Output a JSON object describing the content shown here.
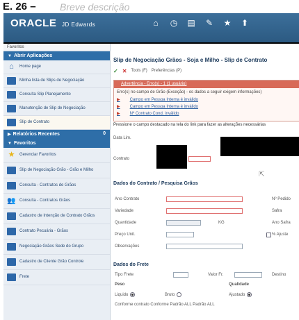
{
  "caption": {
    "label": "E. 26 –",
    "description": "Breve descrição"
  },
  "header": {
    "logo": "ORACLE",
    "logo_suffix": "JD Edwards",
    "icons": [
      "home-icon",
      "clock-icon",
      "grid-icon",
      "edit-icon",
      "star-icon",
      "pin-icon"
    ]
  },
  "sidebar": {
    "favorites": "Favoritos",
    "my_sections_title": "Abrir Aplicações",
    "items": [
      {
        "label": "Home page",
        "icon": "home"
      },
      {
        "label": "Minha lista de Slips de Negociação",
        "icon": "doc"
      },
      {
        "label": "Consulta Slip Planejamento",
        "icon": "doc"
      },
      {
        "label": "Manutenção de Slip de Negociação",
        "icon": "doc"
      },
      {
        "label": "Slip de Contrato",
        "icon": "doc"
      }
    ],
    "recent_title": "Relatórios Recentes",
    "recent_count": "0",
    "favorites_title": "Favoritos",
    "fav_items": [
      {
        "label": "Gerenciar Favoritos",
        "icon": "star"
      },
      {
        "label": "Slip de Negociação Grão - Grão e Milho",
        "icon": "doc"
      },
      {
        "label": "Consulta - Contratos de Grãos",
        "icon": "doc"
      },
      {
        "label": "Consulta - Contratos Grãos",
        "icon": "people"
      },
      {
        "label": "Cadastro de Intenção de Contrato Grãos",
        "icon": "doc"
      },
      {
        "label": "Contrato Pecuária - Grãos",
        "icon": "doc"
      },
      {
        "label": "Negociação Grãos Sede do Grupo",
        "icon": "doc"
      },
      {
        "label": "Cadastro de Cliente Grão Controle",
        "icon": "doc"
      },
      {
        "label": "Frete",
        "icon": "doc"
      }
    ]
  },
  "main": {
    "title": "Slip de Negociação Grãos - Soja e Milho - Slip de Contrato",
    "toolbar": {
      "ok": "✓",
      "cancel": "✕",
      "tools": "Tools (F)",
      "prefs": "Preferências (P)"
    },
    "alert": {
      "tag": "Advertência - Erro(s) - 1 (1 usuário)",
      "lines": [
        "Erro(s) no campo de Grão (Exceção) - os dados a seguir exigem informações)",
        "Campo em Pessoa Interna é inválido",
        "Campo em Pessoa Interna é inválido",
        "Nº Contrato Cond. inválido"
      ],
      "info": "Pressione o campo destacado na tela do link para fazer as alterações necessárias"
    },
    "fields": {
      "label_a": "Data Lim.",
      "label_b": "Contrato"
    },
    "section1": {
      "title": "Dados do Contrato / Pesquisa Grãos",
      "rows": [
        "Ano Contrato",
        "Variedade",
        "Quantidade",
        "Preço Unit.",
        "Observações"
      ],
      "right_labels": [
        "Nº Pedido",
        "Safra",
        "Ano Safra",
        "% Ajuste"
      ],
      "unit": "KG"
    },
    "section2": {
      "title": "Dados do Frete",
      "freight_label": "Tipo Frete",
      "value_label": "Valor Fr.",
      "right_label": "Destino",
      "weight_label": "Peso",
      "quality_label": "Qualidade",
      "options": [
        "Liquido",
        "Bruto",
        "Ajustado"
      ],
      "footer": "Conforme contrato   Conforme Padrão ALL   Padrão ALL"
    }
  }
}
